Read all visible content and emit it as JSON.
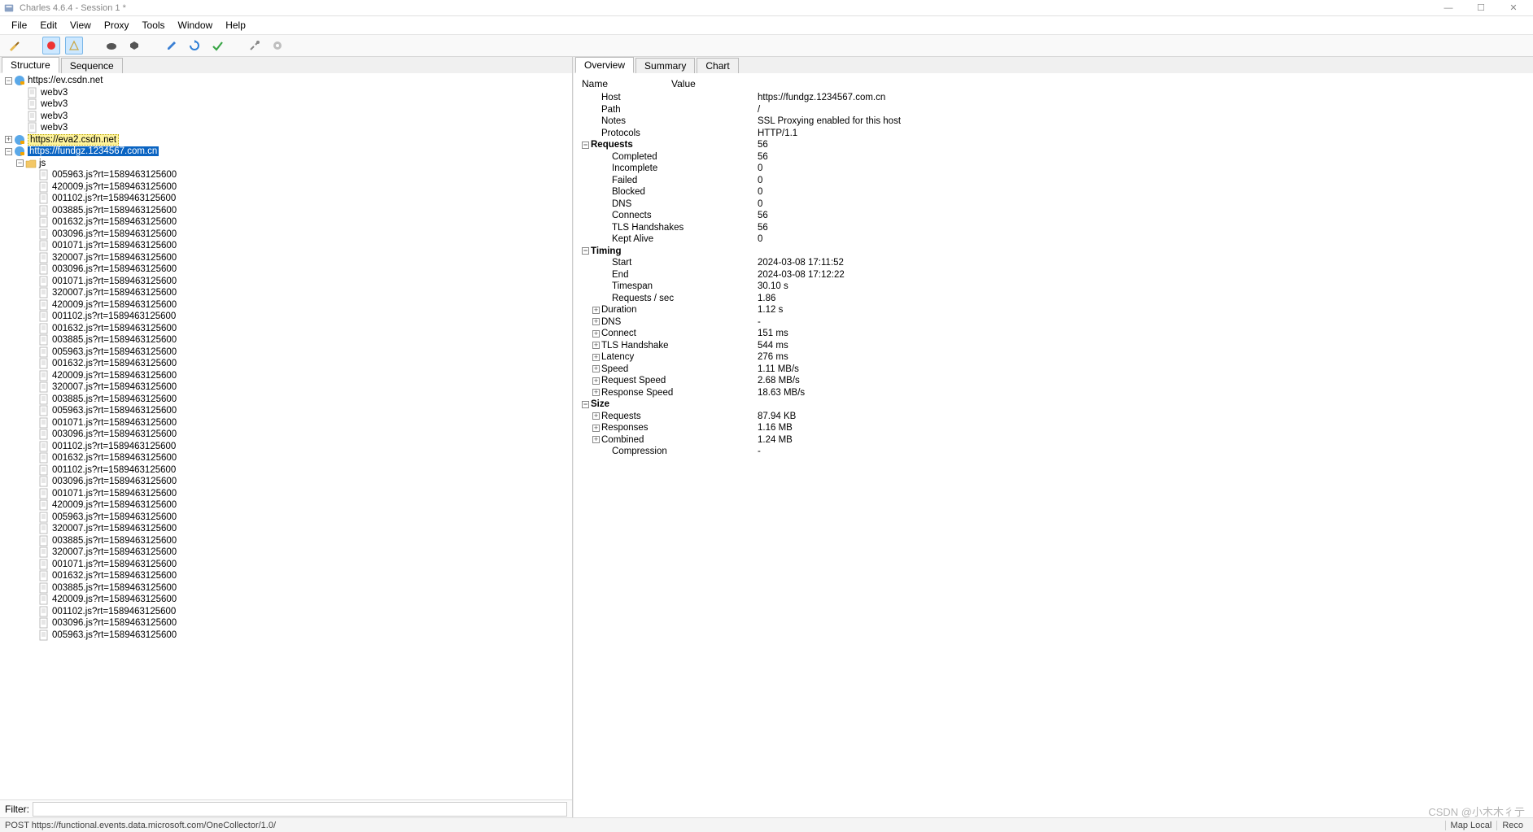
{
  "window": {
    "title": "Charles 4.6.4 - Session 1 *"
  },
  "menu": [
    "File",
    "Edit",
    "View",
    "Proxy",
    "Tools",
    "Window",
    "Help"
  ],
  "left_tabs": [
    "Structure",
    "Sequence"
  ],
  "left_active_tab": 0,
  "right_tabs": [
    "Overview",
    "Summary",
    "Chart"
  ],
  "right_active_tab": 0,
  "filter": {
    "label": "Filter:",
    "value": ""
  },
  "statusbar": {
    "left": "POST https://functional.events.data.microsoft.com/OneCollector/1.0/",
    "cell1": "Map Local",
    "cell2": "Reco"
  },
  "watermark": "CSDN @小木木彳亍",
  "tree": {
    "hosts": [
      {
        "label": "https://ev.csdn.net",
        "expanded": true,
        "highlight": "none",
        "children": [
          "webv3",
          "webv3",
          "webv3",
          "webv3"
        ]
      },
      {
        "label": "https://eva2.csdn.net",
        "expanded": false,
        "highlight": "eva2",
        "children": []
      },
      {
        "label": "https://fundgz.1234567.com.cn",
        "expanded": true,
        "highlight": "selected",
        "folders": [
          {
            "label": "js",
            "expanded": true,
            "files": [
              "005963.js?rt=1589463125600",
              "420009.js?rt=1589463125600",
              "001102.js?rt=1589463125600",
              "003885.js?rt=1589463125600",
              "001632.js?rt=1589463125600",
              "003096.js?rt=1589463125600",
              "001071.js?rt=1589463125600",
              "320007.js?rt=1589463125600",
              "003096.js?rt=1589463125600",
              "001071.js?rt=1589463125600",
              "320007.js?rt=1589463125600",
              "420009.js?rt=1589463125600",
              "001102.js?rt=1589463125600",
              "001632.js?rt=1589463125600",
              "003885.js?rt=1589463125600",
              "005963.js?rt=1589463125600",
              "001632.js?rt=1589463125600",
              "420009.js?rt=1589463125600",
              "320007.js?rt=1589463125600",
              "003885.js?rt=1589463125600",
              "005963.js?rt=1589463125600",
              "001071.js?rt=1589463125600",
              "003096.js?rt=1589463125600",
              "001102.js?rt=1589463125600",
              "001632.js?rt=1589463125600",
              "001102.js?rt=1589463125600",
              "003096.js?rt=1589463125600",
              "001071.js?rt=1589463125600",
              "420009.js?rt=1589463125600",
              "005963.js?rt=1589463125600",
              "320007.js?rt=1589463125600",
              "003885.js?rt=1589463125600",
              "320007.js?rt=1589463125600",
              "001071.js?rt=1589463125600",
              "001632.js?rt=1589463125600",
              "003885.js?rt=1589463125600",
              "420009.js?rt=1589463125600",
              "001102.js?rt=1589463125600",
              "003096.js?rt=1589463125600",
              "005963.js?rt=1589463125600"
            ]
          }
        ]
      }
    ]
  },
  "overview": {
    "header": {
      "name": "Name",
      "value": "Value"
    },
    "rows": [
      {
        "indent": 1,
        "name": "Host",
        "value": "https://fundgz.1234567.com.cn"
      },
      {
        "indent": 1,
        "name": "Path",
        "value": "/"
      },
      {
        "indent": 1,
        "name": "Notes",
        "value": "SSL Proxying enabled for this host"
      },
      {
        "indent": 1,
        "name": "Protocols",
        "value": "HTTP/1.1"
      },
      {
        "group": true,
        "twist": "-",
        "indent": 0,
        "name": "Requests",
        "value": "56"
      },
      {
        "indent": 2,
        "name": "Completed",
        "value": "56"
      },
      {
        "indent": 2,
        "name": "Incomplete",
        "value": "0"
      },
      {
        "indent": 2,
        "name": "Failed",
        "value": "0"
      },
      {
        "indent": 2,
        "name": "Blocked",
        "value": "0"
      },
      {
        "indent": 2,
        "name": "DNS",
        "value": "0"
      },
      {
        "indent": 2,
        "name": "Connects",
        "value": "56"
      },
      {
        "indent": 2,
        "name": "TLS Handshakes",
        "value": "56"
      },
      {
        "indent": 2,
        "name": "Kept Alive",
        "value": "0"
      },
      {
        "group": true,
        "twist": "-",
        "indent": 0,
        "name": "Timing",
        "value": ""
      },
      {
        "indent": 2,
        "name": "Start",
        "value": "2024-03-08 17:11:52"
      },
      {
        "indent": 2,
        "name": "End",
        "value": "2024-03-08 17:12:22"
      },
      {
        "indent": 2,
        "name": "Timespan",
        "value": "30.10 s"
      },
      {
        "indent": 2,
        "name": "Requests / sec",
        "value": "1.86"
      },
      {
        "twist": "+",
        "indent": 1,
        "name": "Duration",
        "value": "1.12 s"
      },
      {
        "twist": "+",
        "indent": 1,
        "name": "DNS",
        "value": "-"
      },
      {
        "twist": "+",
        "indent": 1,
        "name": "Connect",
        "value": "151 ms"
      },
      {
        "twist": "+",
        "indent": 1,
        "name": "TLS Handshake",
        "value": "544 ms"
      },
      {
        "twist": "+",
        "indent": 1,
        "name": "Latency",
        "value": "276 ms"
      },
      {
        "twist": "+",
        "indent": 1,
        "name": "Speed",
        "value": "1.11 MB/s"
      },
      {
        "twist": "+",
        "indent": 1,
        "name": "Request Speed",
        "value": "2.68 MB/s"
      },
      {
        "twist": "+",
        "indent": 1,
        "name": "Response Speed",
        "value": "18.63 MB/s"
      },
      {
        "group": true,
        "twist": "-",
        "indent": 0,
        "name": "Size",
        "value": ""
      },
      {
        "twist": "+",
        "indent": 1,
        "name": "Requests",
        "value": "87.94 KB"
      },
      {
        "twist": "+",
        "indent": 1,
        "name": "Responses",
        "value": "1.16 MB"
      },
      {
        "twist": "+",
        "indent": 1,
        "name": "Combined",
        "value": "1.24 MB"
      },
      {
        "indent": 2,
        "name": "Compression",
        "value": "-"
      }
    ]
  }
}
